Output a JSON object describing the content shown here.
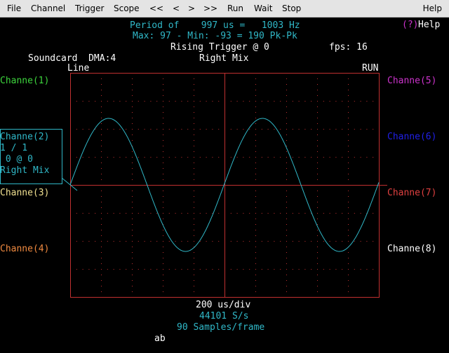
{
  "menu": {
    "file": "File",
    "channel": "Channel",
    "trigger": "Trigger",
    "scope": "Scope",
    "rewind": "<<",
    "back": "<",
    "forward": ">",
    "fast_forward": ">>",
    "run": "Run",
    "wait": "Wait",
    "stop": "Stop",
    "help": "Help"
  },
  "header": {
    "period_line": "Period of    997 us =   1003 Hz",
    "pk_line": "Max: 97 - Min: -93 = 190 Pk-Pk",
    "trigger_line": "Rising Trigger @ 0",
    "fps": "fps: 16",
    "soundcard": "Soundcard  DMA:4",
    "source": "Right Mix",
    "line_label": "Line",
    "run_status": "RUN",
    "help_q": "(?)",
    "help_label": "Help"
  },
  "channels_left": [
    {
      "label": "Channe(1)",
      "color": "#3dd53d"
    },
    {
      "label": "Channe(2)",
      "color": "#30b8c8"
    },
    {
      "label": "Channe(3)",
      "color": "#f0e090"
    },
    {
      "label": "Channe(4)",
      "color": "#f08a40"
    }
  ],
  "channel2_info": {
    "scale": "1 / 1",
    "offset": " 0 @ 0",
    "source": "Right Mix"
  },
  "channels_right": [
    {
      "label": "Channe(5)",
      "color": "#cc33cc"
    },
    {
      "label": "Channe(6)",
      "color": "#2020e8"
    },
    {
      "label": "Channe(7)",
      "color": "#e04040"
    },
    {
      "label": "Channe(8)",
      "color": "#ffffff"
    }
  ],
  "footer": {
    "timebase": "200 us/div",
    "sample_rate": "44101 S/s",
    "samples_per_frame": "90 Samples/frame",
    "ab": "ab"
  },
  "chart_data": {
    "type": "line",
    "series": [
      {
        "color": "#30b8c8",
        "shape": "sine",
        "period_us": 997,
        "max": 97,
        "min": -93
      }
    ],
    "time_per_div_us": 200,
    "divisions_x": 10,
    "divisions_y": 8,
    "grid": true,
    "grid_color": "#c03030",
    "frame_color": "#c03030"
  }
}
